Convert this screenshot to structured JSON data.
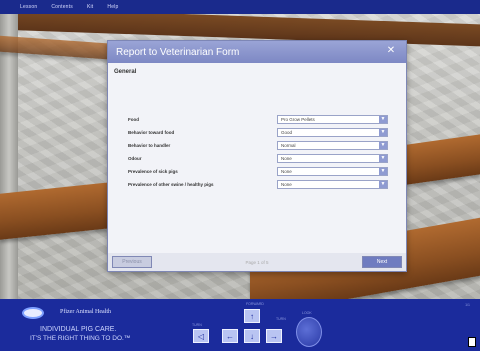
{
  "menu": {
    "items": [
      "Lesson",
      "Contents",
      "Kit",
      "Help"
    ]
  },
  "dialog": {
    "title": "Report to Veterinarian Form",
    "close_glyph": "✕",
    "section_label": "General",
    "fields": [
      {
        "label": "Food",
        "value": "Pro Grow Pellets"
      },
      {
        "label": "Behavior toward food",
        "value": "Good"
      },
      {
        "label": "Behavior to handler",
        "value": "Normal"
      },
      {
        "label": "Odour",
        "value": "None"
      },
      {
        "label": "Prevalence of sick pigs",
        "value": "None"
      },
      {
        "label": "Prevalence of other swine / healthy pigs",
        "value": "None"
      }
    ],
    "prev_label": "Previous",
    "page_info": "Page 1 of 5",
    "next_label": "Next"
  },
  "footer": {
    "brand": "Pfizer Animal Health",
    "slogan_line1": "INDIVIDUAL PIG CARE.",
    "slogan_line2": "IT'S THE RIGHT THING TO DO.™",
    "nav_label_up": "FORWARD",
    "nav_label_left": "TURN",
    "nav_label_right": "TURN",
    "dial_label": "LOOK",
    "nav_glyphs": {
      "up": "↑",
      "down": "↓",
      "left": "←",
      "right": "→",
      "left_far": "◁"
    },
    "corner_tag": "1/1"
  },
  "colors": {
    "bar": "#1a2a8c",
    "panel": "#1b2b9c",
    "dialog_title": "#7d88c4",
    "next_button": "#6f7cc0"
  }
}
